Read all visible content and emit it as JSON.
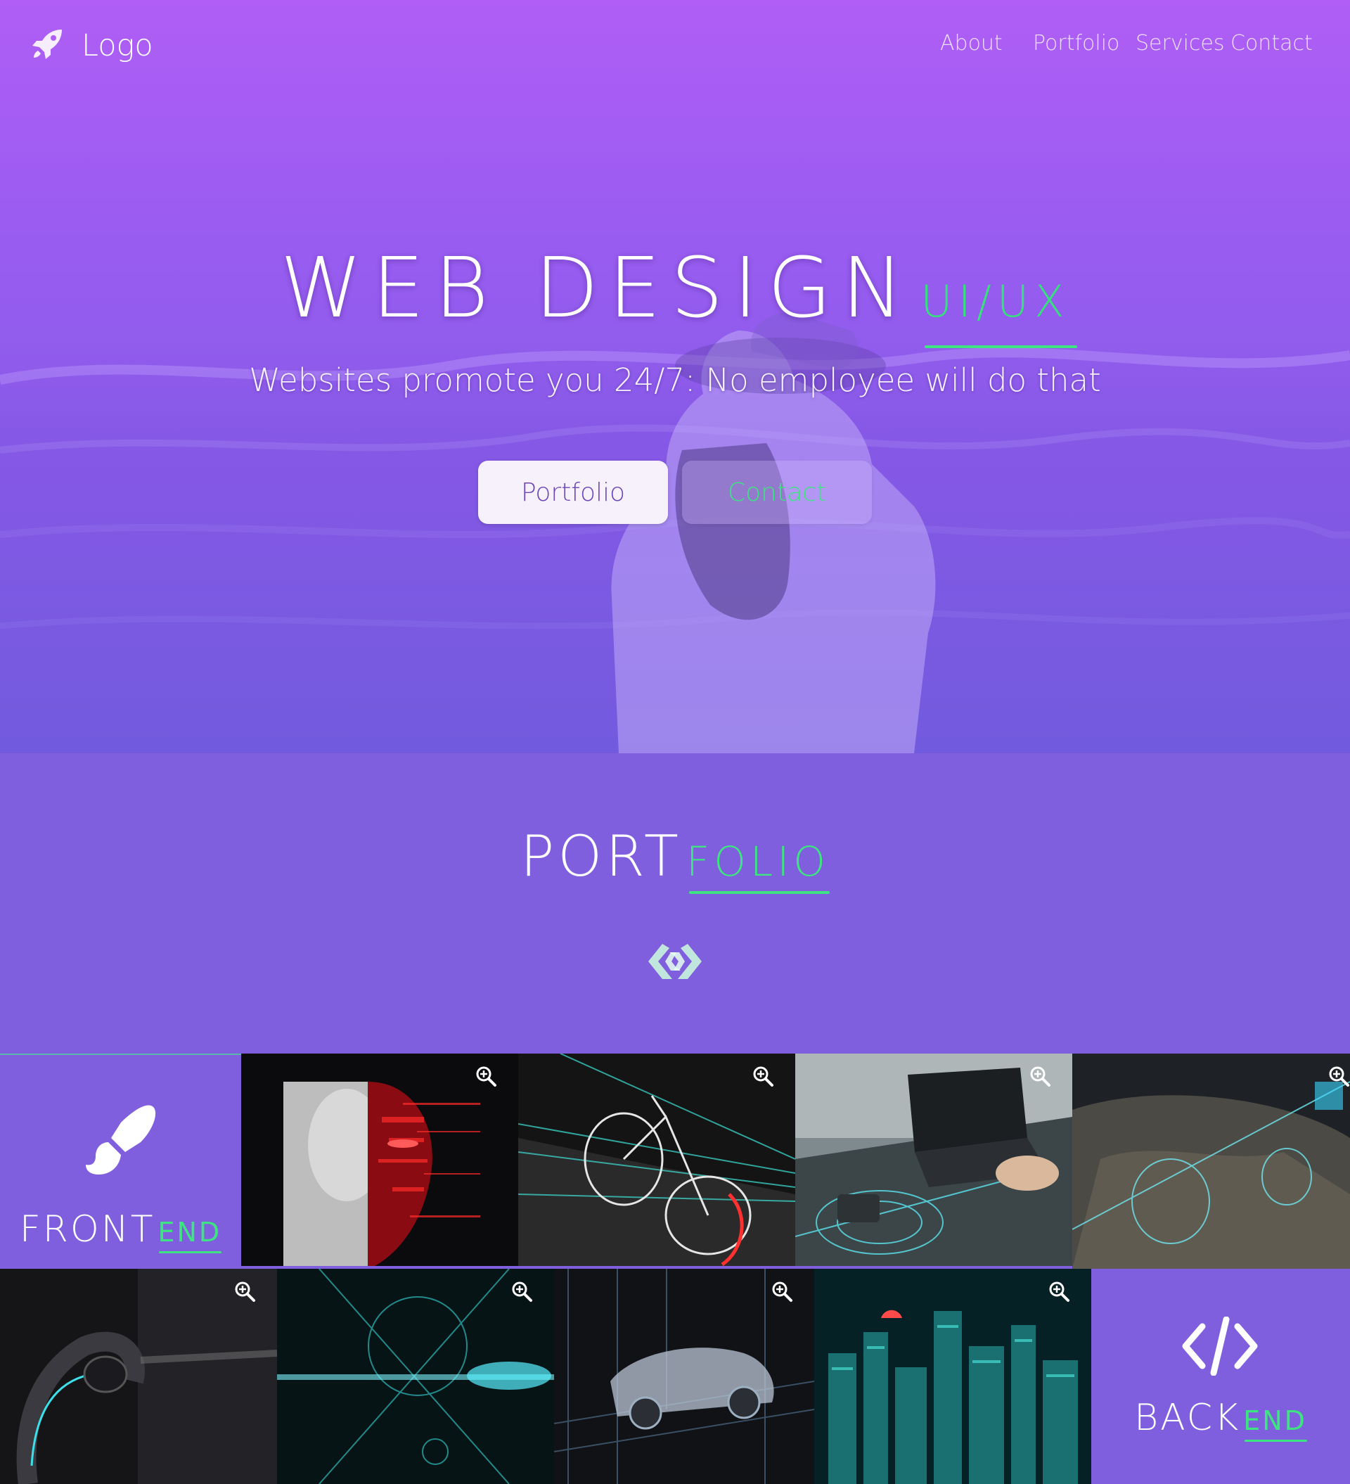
{
  "header": {
    "logo_text": "Logo",
    "logo_icon": "rocket-icon",
    "nav": [
      {
        "label": "About"
      },
      {
        "label": "Portfolio"
      },
      {
        "label": "Services"
      },
      {
        "label": "Contact"
      }
    ]
  },
  "hero": {
    "title": "WEB DESIGN",
    "title_accent": "UI/UX",
    "tagline": "Websites promote you 24/7: No employee will do that",
    "buttons": [
      {
        "label": "Portfolio"
      },
      {
        "label": "Contact"
      }
    ]
  },
  "portfolio": {
    "title": "PORT",
    "title_accent": "FOLIO",
    "divider_icon": "linked-diamonds-icon"
  },
  "gallery": {
    "frontend": {
      "label": "FRONT",
      "label_accent": "END",
      "icon": "paintbrush-icon"
    },
    "backend": {
      "label": "BACK",
      "label_accent": "END",
      "icon": "code-icon"
    },
    "zoom_icon": "zoom-in-icon"
  },
  "colors": {
    "accent": "#3ee482",
    "primary": "#7f5fdd",
    "hero_top": "#b05ef5"
  }
}
